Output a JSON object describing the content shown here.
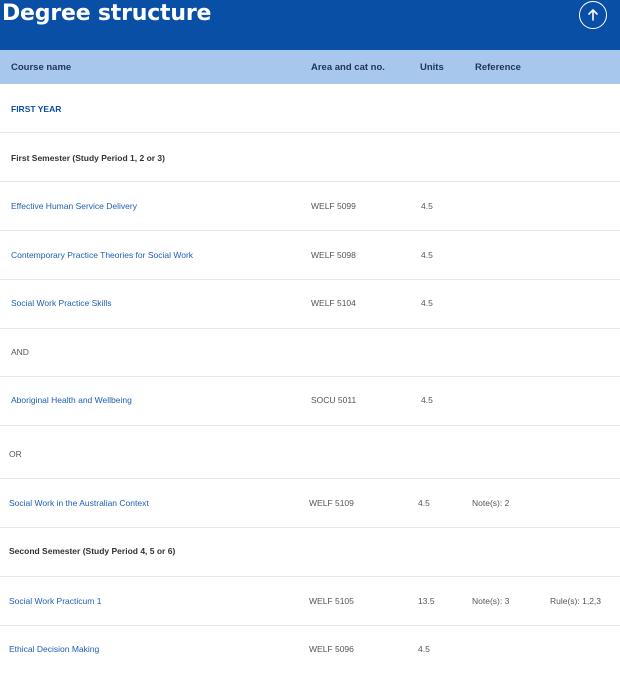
{
  "header": {
    "title": "Degree structure",
    "up_icon": "arrow-up-circle-icon",
    "background": "#0a4fa6"
  },
  "table": {
    "columns": {
      "course": "Course name",
      "area": "Area and cat no.",
      "units": "Units",
      "reference": "Reference"
    },
    "header_background": "#a7c8ec",
    "rows": [
      {
        "type": "year",
        "label": "FIRST YEAR"
      },
      {
        "type": "semester",
        "label": "First Semester (Study Period 1, 2 or 3)"
      },
      {
        "type": "course",
        "name": "Effective Human Service Delivery",
        "area": "WELF 5099",
        "units": "4.5",
        "note": "",
        "rule": ""
      },
      {
        "type": "course",
        "name": "Contemporary Practice Theories for Social Work",
        "area": "WELF 5098",
        "units": "4.5",
        "note": "",
        "rule": ""
      },
      {
        "type": "course",
        "name": "Social Work Practice Skills",
        "area": "WELF 5104",
        "units": "4.5",
        "note": "",
        "rule": ""
      },
      {
        "type": "connector",
        "label": "AND"
      },
      {
        "type": "course",
        "name": "Aboriginal Health and Wellbeing",
        "area": "SOCU 5011",
        "units": "4.5",
        "note": "",
        "rule": ""
      },
      {
        "type": "connector",
        "label": "OR"
      },
      {
        "type": "course",
        "name": "Social Work in the Australian Context",
        "area": "WELF 5109",
        "units": "4.5",
        "note": "Note(s): 2",
        "rule": ""
      },
      {
        "type": "semester",
        "label": "Second Semester (Study Period 4, 5 or 6)"
      },
      {
        "type": "course",
        "name": "Social Work Practicum 1",
        "area": "WELF 5105",
        "units": "13.5",
        "note": "Note(s): 3",
        "rule": "Rule(s): 1,2,3"
      },
      {
        "type": "course",
        "name": "Ethical Decision Making",
        "area": "WELF 5096",
        "units": "4.5",
        "note": "",
        "rule": ""
      }
    ]
  }
}
